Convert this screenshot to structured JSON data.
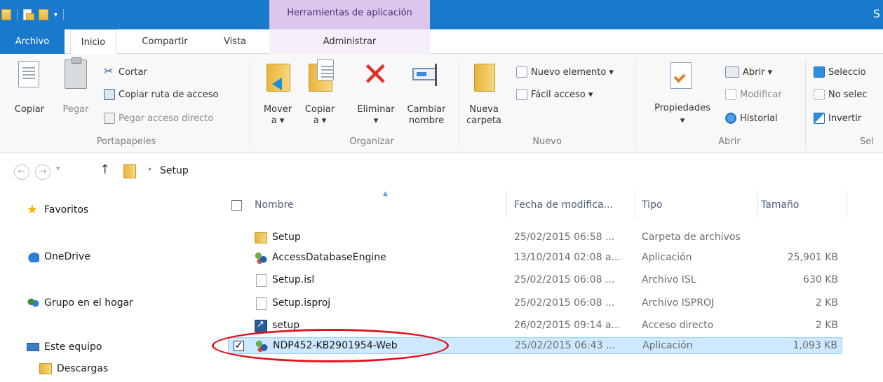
{
  "titlebar": {
    "tools_context_title": "Herramientas de aplicación",
    "window_title_partial": "S"
  },
  "tabs": {
    "file": "Archivo",
    "home": "Inicio",
    "share": "Compartir",
    "view": "Vista",
    "manage": "Administrar"
  },
  "ribbon": {
    "clipboard": {
      "label": "Portapapeles",
      "copy": "Copiar",
      "paste": "Pegar",
      "cut": "Cortar",
      "copy_path": "Copiar ruta de acceso",
      "paste_shortcut": "Pegar acceso directo"
    },
    "organize": {
      "label": "Organizar",
      "move_to_l1": "Mover",
      "move_to_l2": "a ▾",
      "copy_to_l1": "Copiar",
      "copy_to_l2": "a ▾",
      "delete_l1": "Eliminar",
      "delete_l2": "▾",
      "rename_l1": "Cambiar",
      "rename_l2": "nombre"
    },
    "new": {
      "label": "Nuevo",
      "new_folder_l1": "Nueva",
      "new_folder_l2": "carpeta",
      "new_item": "Nuevo elemento ▾",
      "easy_access": "Fácil acceso ▾"
    },
    "open": {
      "label": "Abrir",
      "properties": "Propiedades",
      "properties_drop": "▾",
      "open": "Abrir ▾",
      "edit": "Modificar",
      "history": "Historial"
    },
    "select": {
      "label_partial": "Sel",
      "select_all_partial": "Seleccio",
      "select_none_partial": "No selec",
      "invert_partial": "Invertir"
    }
  },
  "address": {
    "back": "←",
    "forward": "→",
    "recent": "▾",
    "up": "↑",
    "separator": "▸",
    "crumb": "Setup"
  },
  "nav_pane": {
    "favorites": "Favoritos",
    "onedrive": "OneDrive",
    "homegroup": "Grupo en el hogar",
    "this_pc": "Este equipo",
    "downloads": "Descargas"
  },
  "columns": {
    "name": "Nombre",
    "date": "Fecha de modifica...",
    "type": "Tipo",
    "size": "Tamaño"
  },
  "files": [
    {
      "name": "Setup",
      "date": "25/02/2015 06:58 ...",
      "type": "Carpeta de archivos",
      "size": "",
      "icon": "folder-icon"
    },
    {
      "name": "AccessDatabaseEngine",
      "date": "13/10/2014 02:08 a...",
      "type": "Aplicación",
      "size": "25,901 KB",
      "icon": "installer-icon"
    },
    {
      "name": "Setup.isl",
      "date": "25/02/2015 06:08 ...",
      "type": "Archivo ISL",
      "size": "630 KB",
      "icon": "document-icon"
    },
    {
      "name": "Setup.isproj",
      "date": "25/02/2015 06:08 ...",
      "type": "Archivo ISPROJ",
      "size": "2 KB",
      "icon": "document-icon"
    },
    {
      "name": "setup",
      "date": "26/02/2015 09:14 a...",
      "type": "Acceso directo",
      "size": "2 KB",
      "icon": "shortcut-icon"
    },
    {
      "name": "NDP452-KB2901954-Web",
      "date": "25/02/2015 06:43 ...",
      "type": "Aplicación",
      "size": "1,093 KB",
      "icon": "installer-icon",
      "selected": true,
      "checkmark": "✓"
    }
  ],
  "colors": {
    "titlebar": "#1979ca",
    "tools_context": "#dbc7ee",
    "selection": "#cde8ff",
    "annotation": "#e0121b"
  }
}
